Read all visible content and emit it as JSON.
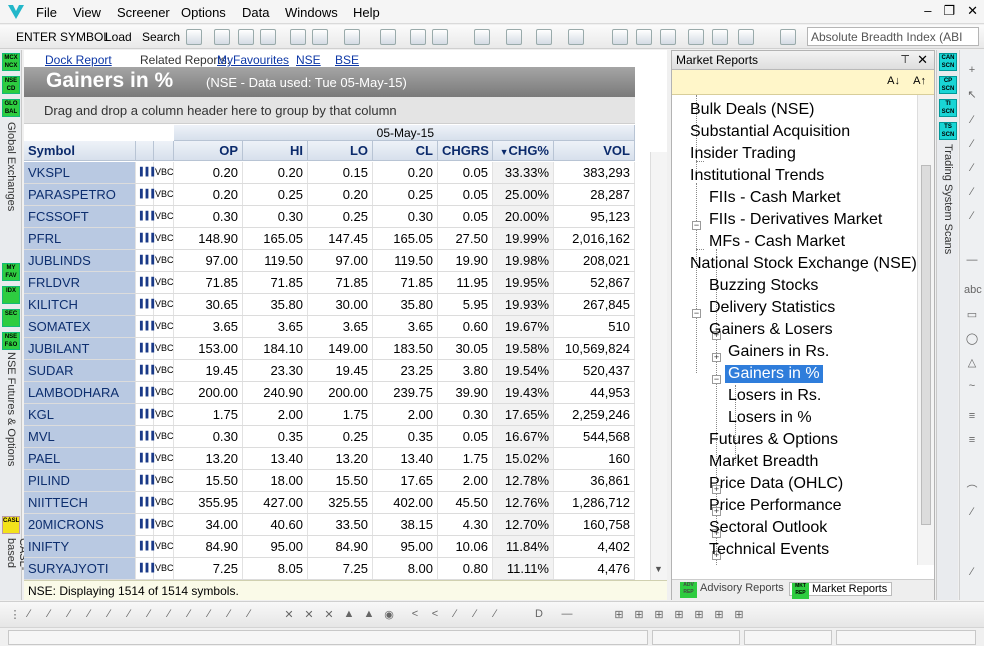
{
  "menu": {
    "items": [
      "File",
      "View",
      "Screener",
      "Options",
      "Data",
      "Windows",
      "Help"
    ]
  },
  "toolbar": {
    "enter_symbol": "ENTER SYMBOL",
    "load": "Load",
    "search": "Search",
    "analysis_select": "Absolute Breadth Index (ABI"
  },
  "left_strip": {
    "badges": [
      "MCX NCX",
      "NSE CD",
      "GLO BAL",
      "MY FAV",
      "IDX",
      "SEC",
      "NSE F&O",
      "CASL"
    ],
    "labels": [
      "Global Exchanges",
      "NSE Futures & Options",
      "CASL-based"
    ]
  },
  "report": {
    "related_links": {
      "dock": "Dock Report",
      "related_label": "Related Reports:",
      "fav": "MyFavourites",
      "nse": "NSE",
      "bse": "BSE"
    },
    "title": "Gainers in %",
    "subtitle": "(NSE - Data used: Tue 05-May-15)",
    "group_hint": "Drag and drop a column header here to group by that column",
    "date_header": "05-May-15",
    "columns": [
      "Symbol",
      "OP",
      "HI",
      "LO",
      "CL",
      "CHGRS",
      "CHG%",
      "VOL"
    ],
    "row_icons": {
      "chart": "▐▐▐",
      "vbc": "VBC"
    },
    "rows": [
      [
        "VKSPL",
        "0.20",
        "0.20",
        "0.15",
        "0.20",
        "0.05",
        "33.33%",
        "383,293"
      ],
      [
        "PARASPETRO",
        "0.20",
        "0.25",
        "0.20",
        "0.25",
        "0.05",
        "25.00%",
        "28,287"
      ],
      [
        "FCSSOFT",
        "0.30",
        "0.30",
        "0.25",
        "0.30",
        "0.05",
        "20.00%",
        "95,123"
      ],
      [
        "PFRL",
        "148.90",
        "165.05",
        "147.45",
        "165.05",
        "27.50",
        "19.99%",
        "2,016,162"
      ],
      [
        "JUBLINDS",
        "97.00",
        "119.50",
        "97.00",
        "119.50",
        "19.90",
        "19.98%",
        "208,021"
      ],
      [
        "FRLDVR",
        "71.85",
        "71.85",
        "71.85",
        "71.85",
        "11.95",
        "19.95%",
        "52,867"
      ],
      [
        "KILITCH",
        "30.65",
        "35.80",
        "30.00",
        "35.80",
        "5.95",
        "19.93%",
        "267,845"
      ],
      [
        "SOMATEX",
        "3.65",
        "3.65",
        "3.65",
        "3.65",
        "0.60",
        "19.67%",
        "510"
      ],
      [
        "JUBILANT",
        "153.00",
        "184.10",
        "149.00",
        "183.50",
        "30.05",
        "19.58%",
        "10,569,824"
      ],
      [
        "SUDAR",
        "19.45",
        "23.30",
        "19.45",
        "23.25",
        "3.80",
        "19.54%",
        "520,437"
      ],
      [
        "LAMBODHARA",
        "200.00",
        "240.90",
        "200.00",
        "239.75",
        "39.90",
        "19.43%",
        "44,953"
      ],
      [
        "KGL",
        "1.75",
        "2.00",
        "1.75",
        "2.00",
        "0.30",
        "17.65%",
        "2,259,246"
      ],
      [
        "MVL",
        "0.30",
        "0.35",
        "0.25",
        "0.35",
        "0.05",
        "16.67%",
        "544,568"
      ],
      [
        "PAEL",
        "13.20",
        "13.40",
        "13.20",
        "13.40",
        "1.75",
        "15.02%",
        "160"
      ],
      [
        "PILIND",
        "15.50",
        "18.00",
        "15.50",
        "17.65",
        "2.00",
        "12.78%",
        "36,861"
      ],
      [
        "NIITTECH",
        "355.95",
        "427.00",
        "325.55",
        "402.00",
        "45.50",
        "12.76%",
        "1,286,712"
      ],
      [
        "20MICRONS",
        "34.00",
        "40.60",
        "33.50",
        "38.15",
        "4.30",
        "12.70%",
        "160,758"
      ],
      [
        "INIFTY",
        "84.90",
        "95.00",
        "84.90",
        "95.00",
        "10.06",
        "11.84%",
        "4,402"
      ],
      [
        "SURYAJYOTI",
        "7.25",
        "8.05",
        "7.25",
        "8.00",
        "0.80",
        "11.11%",
        "4,476"
      ]
    ],
    "status": "NSE: Displaying 1514 of 1514 symbols."
  },
  "panel": {
    "title": "Market Reports",
    "font_buttons": [
      "A↓",
      "A↑"
    ],
    "tree": [
      "Bulk Deals (NSE)",
      "Substantial Acquisition",
      "Insider Trading",
      "Institutional Trends",
      "FIIs - Cash Market",
      "FIIs - Derivatives Market",
      "MFs - Cash Market",
      "National Stock Exchange (NSE)",
      "Buzzing Stocks",
      "Delivery Statistics",
      "Gainers & Losers",
      "Gainers in Rs.",
      "Gainers in %",
      "Losers in Rs.",
      "Losers in %",
      "Futures & Options",
      "Market Breadth",
      "Price Data (OHLC)",
      "Price Performance",
      "Sectoral Outlook",
      "Technical Events"
    ],
    "tabs": [
      "Advisory Reports",
      "Market Reports"
    ],
    "tab_badges": [
      "ADV REP",
      "MKT REP"
    ]
  },
  "right_strip": {
    "badges": [
      "CAN SCN",
      "CP SCN",
      "TI SCN",
      "TS SCN"
    ],
    "label": "Trading System Scans"
  },
  "colors": {
    "accent": "#2f7ddb",
    "symbol_bg": "#b9c9e2",
    "header_text": "#0b2a6b",
    "badge_green": "#2ecc40",
    "badge_cyan": "#19d5d5"
  }
}
